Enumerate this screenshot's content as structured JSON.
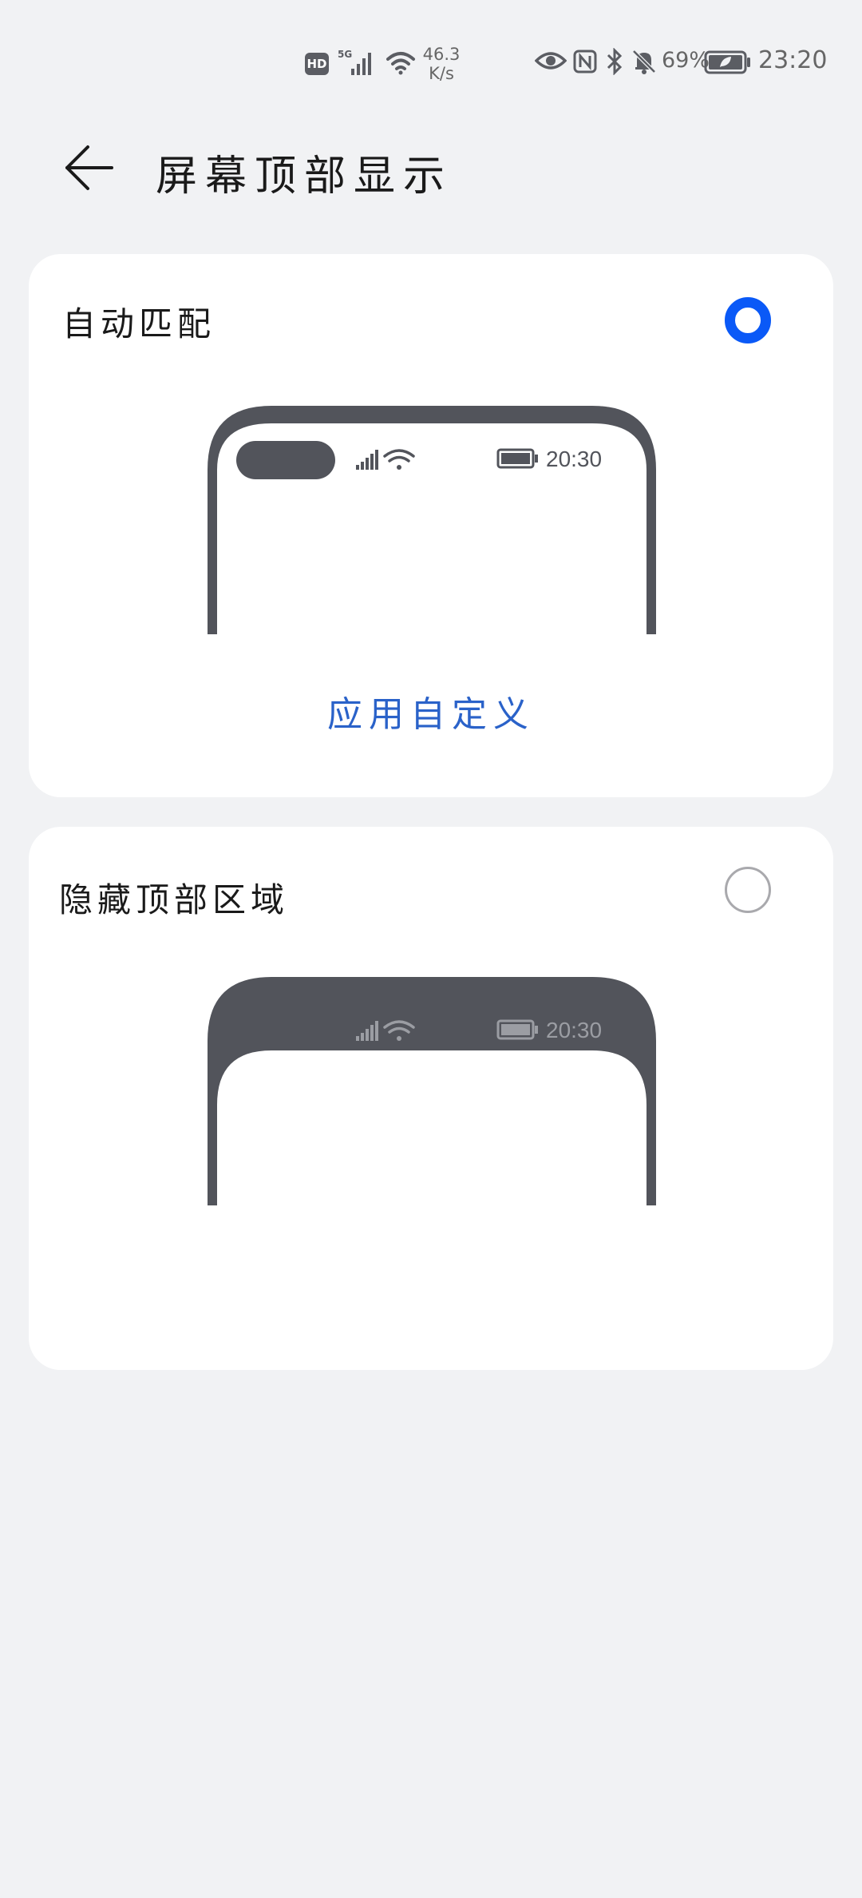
{
  "status_bar": {
    "hd": "HD",
    "network": "5G",
    "speed_value": "46.3",
    "speed_unit": "K/s",
    "battery_percent": "69%",
    "time": "23:20"
  },
  "header": {
    "title": "屏幕顶部显示"
  },
  "options": [
    {
      "label": "自动匹配",
      "selected": true,
      "preview_time": "20:30",
      "link": "应用自定义"
    },
    {
      "label": "隐藏顶部区域",
      "selected": false,
      "preview_time": "20:30"
    }
  ],
  "colors": {
    "accent": "#0a59f7",
    "link": "#2a62c9",
    "phone_frame": "#52545b",
    "background": "#f1f2f4"
  }
}
